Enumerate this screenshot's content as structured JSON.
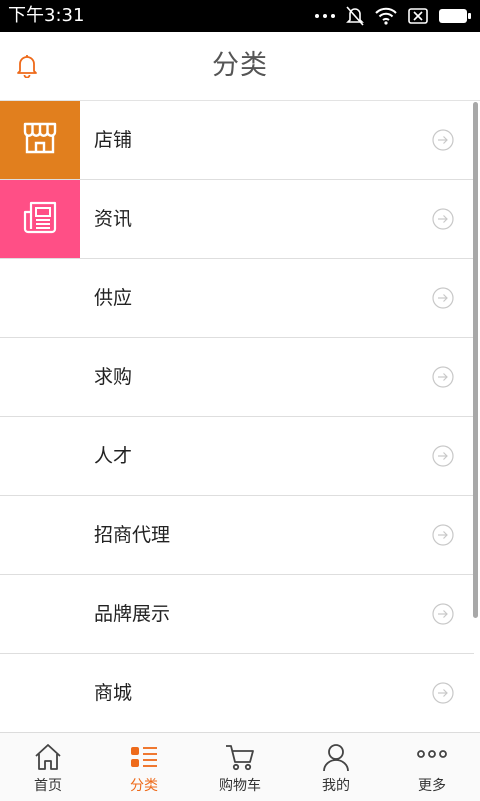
{
  "status_bar": {
    "time": "下午3:31"
  },
  "header": {
    "title": "分类"
  },
  "categories": [
    {
      "label": "店铺",
      "icon": "store-icon",
      "tile_color": "#e17f1e"
    },
    {
      "label": "资讯",
      "icon": "newspaper-icon",
      "tile_color": "#ff4f86"
    },
    {
      "label": "供应"
    },
    {
      "label": "求购"
    },
    {
      "label": "人才"
    },
    {
      "label": "招商代理"
    },
    {
      "label": "品牌展示"
    },
    {
      "label": "商城"
    }
  ],
  "tabbar": {
    "items": [
      {
        "label": "首页",
        "icon": "home-icon",
        "active": false
      },
      {
        "label": "分类",
        "icon": "category-icon",
        "active": true
      },
      {
        "label": "购物车",
        "icon": "cart-icon",
        "active": false
      },
      {
        "label": "我的",
        "icon": "user-icon",
        "active": false
      },
      {
        "label": "更多",
        "icon": "more-icon",
        "active": false
      }
    ]
  },
  "colors": {
    "accent": "#ee6a1a",
    "store_tile": "#e17f1e",
    "news_tile": "#ff4f86"
  }
}
